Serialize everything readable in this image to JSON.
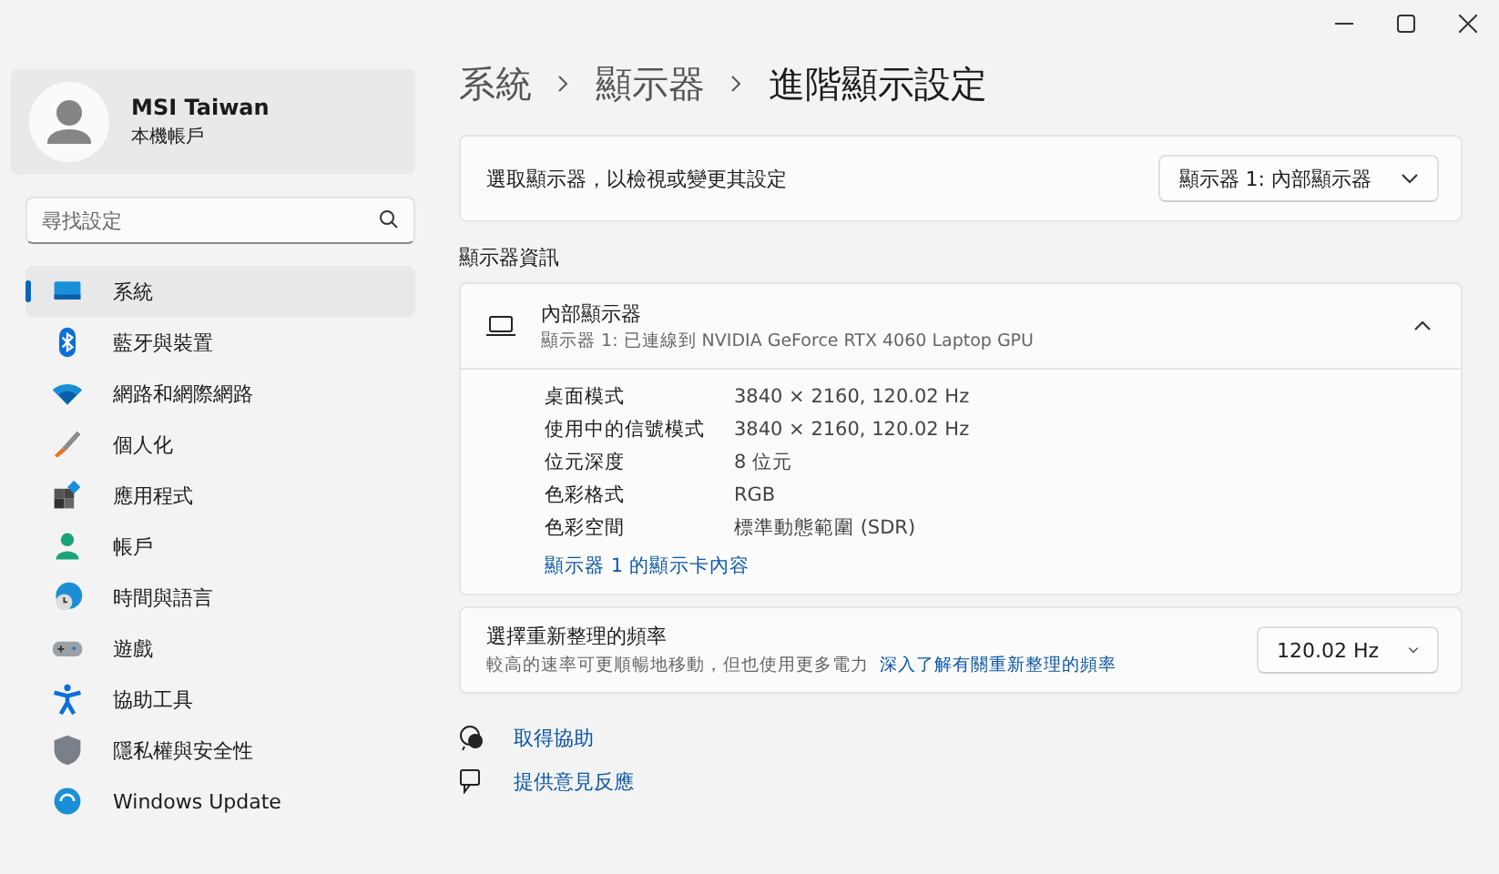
{
  "account": {
    "name": "MSI Taiwan",
    "type": "本機帳戶"
  },
  "search": {
    "placeholder": "尋找設定"
  },
  "nav": [
    {
      "label": "系統",
      "selected": true
    },
    {
      "label": "藍牙與裝置",
      "selected": false
    },
    {
      "label": "網路和網際網路",
      "selected": false
    },
    {
      "label": "個人化",
      "selected": false
    },
    {
      "label": "應用程式",
      "selected": false
    },
    {
      "label": "帳戶",
      "selected": false
    },
    {
      "label": "時間與語言",
      "selected": false
    },
    {
      "label": "遊戲",
      "selected": false
    },
    {
      "label": "協助工具",
      "selected": false
    },
    {
      "label": "隱私權與安全性",
      "selected": false
    },
    {
      "label": "Windows Update",
      "selected": false
    }
  ],
  "breadcrumb": [
    "系統",
    "顯示器",
    "進階顯示設定"
  ],
  "select_display": {
    "label": "選取顯示器，以檢視或變更其設定",
    "value": "顯示器 1: 內部顯示器"
  },
  "section_title": "顯示器資訊",
  "display_card": {
    "title": "內部顯示器",
    "subtitle": "顯示器 1: 已連線到 NVIDIA GeForce RTX 4060 Laptop GPU",
    "expanded": true,
    "details": [
      {
        "label": "桌面模式",
        "value": "3840 × 2160, 120.02 Hz"
      },
      {
        "label": "使用中的信號模式",
        "value": "3840 × 2160, 120.02 Hz"
      },
      {
        "label": "位元深度",
        "value": "8 位元"
      },
      {
        "label": "色彩格式",
        "value": "RGB"
      },
      {
        "label": "色彩空間",
        "value": "標準動態範圍 (SDR)"
      }
    ],
    "link": "顯示器 1 的顯示卡內容"
  },
  "refresh_rate": {
    "title": "選擇重新整理的頻率",
    "description": "較高的速率可更順暢地移動，但也使用更多電力",
    "link": "深入了解有關重新整理的頻率",
    "value": "120.02 Hz"
  },
  "footer_links": [
    "取得協助",
    "提供意見反應"
  ]
}
